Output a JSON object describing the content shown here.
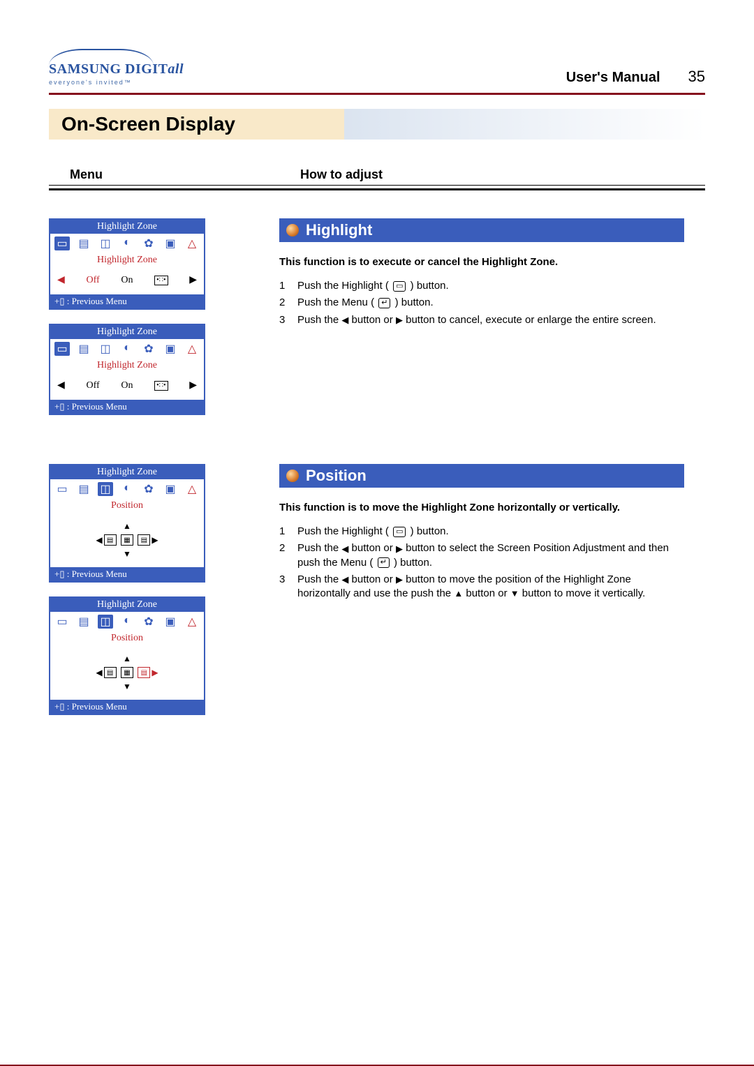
{
  "header": {
    "brand_main": "SAMSUNG DIGIT",
    "brand_suffix": "all",
    "brand_tag": "everyone's invited™",
    "manual_label": "User's Manual",
    "page_number": "35"
  },
  "section_title": "On-Screen Display",
  "columns": {
    "menu_label": "Menu",
    "howto_label": "How to adjust"
  },
  "osd": {
    "title": "Highlight Zone",
    "sub_highlight": "Highlight Zone",
    "sub_position": "Position",
    "off": "Off",
    "on": "On",
    "prev_prefix": "+▯ : ",
    "prev": "Previous Menu"
  },
  "highlight": {
    "title": "Highlight",
    "description": "This function is to execute or cancel the Highlight Zone.",
    "steps": [
      "Push the Highlight ( ▭ ) button.",
      "Push the Menu ( ↵ ) button.",
      "Push the ◀ button or ▶ button to cancel, execute or enlarge the entire screen."
    ]
  },
  "position": {
    "title": "Position",
    "description": "This function is to move the Highlight Zone horizontally or vertically.",
    "steps": [
      "Push the Highlight ( ▭ ) button.",
      "Push the ◀ button or ▶ button to select the Screen Position Adjustment and then push the Menu ( ↵ ) button.",
      "Push the ◀ button or ▶ button to move the position of the Highlight Zone horizontally and use the push the ▲ button or ▼ button to move it vertically."
    ]
  }
}
